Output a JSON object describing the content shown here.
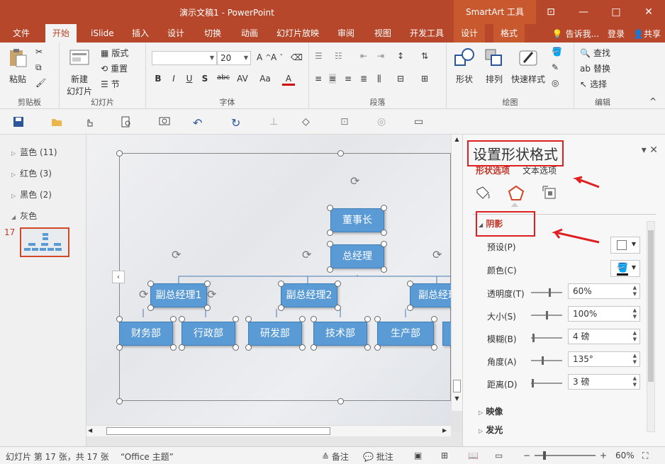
{
  "window": {
    "title": "演示文稿1 - PowerPoint",
    "context_tools": "SmartArt 工具"
  },
  "tabs": [
    "文件",
    "开始",
    "iSlide",
    "插入",
    "设计",
    "切换",
    "动画",
    "幻灯片放映",
    "审阅",
    "视图",
    "开发工具",
    "设计",
    "格式"
  ],
  "tabs_right": {
    "tell": "告诉我...",
    "login": "登录",
    "share": "共享"
  },
  "ribbon": {
    "clipboard": {
      "paste": "粘贴",
      "group": "剪贴板"
    },
    "slides": {
      "new_slide": "新建",
      "new_slide2": "幻灯片",
      "layout": "版式",
      "reset": "重置",
      "section": "节",
      "group": "幻灯片"
    },
    "font": {
      "name": "",
      "size": "20",
      "group": "字体",
      "bold": "B",
      "italic": "I",
      "underline": "U",
      "shadow": "S",
      "strike": "abc",
      "spacing": "AV",
      "case": "Aa",
      "color": "A"
    },
    "paragraph": {
      "group": "段落"
    },
    "drawing": {
      "shapes": "形状",
      "arrange": "排列",
      "quick_styles": "快速样式",
      "group": "绘图"
    },
    "editing": {
      "find": "查找",
      "replace": "替换",
      "select": "选择",
      "group": "编辑"
    }
  },
  "sections": [
    {
      "label": "蓝色 (11)"
    },
    {
      "label": "红色 (3)"
    },
    {
      "label": "黑色 (2)"
    },
    {
      "label": "灰色"
    }
  ],
  "slide_number": "17",
  "org": {
    "top1": "董事长",
    "top2": "总经理",
    "mid": [
      "副总经理1",
      "副总经理2",
      "副总经理"
    ],
    "bottom": [
      "财务部",
      "行政部",
      "研发部",
      "技术部",
      "生产部"
    ]
  },
  "format_pane": {
    "title": "设置形状格式",
    "tab_shape": "形状选项",
    "tab_text": "文本选项",
    "shadow": "阴影",
    "preset": "预设(P)",
    "color": "颜色(C)",
    "transparency": {
      "label": "透明度(T)",
      "value": "60%",
      "level": 0.6
    },
    "size": {
      "label": "大小(S)",
      "value": "100%",
      "level": 0.5
    },
    "blur": {
      "label": "模糊(B)",
      "value": "4 磅",
      "level": 0.05
    },
    "angle": {
      "label": "角度(A)",
      "value": "135°",
      "level": 0.375
    },
    "distance": {
      "label": "距离(D)",
      "value": "3 磅",
      "level": 0.03
    },
    "reflection": "映像",
    "glow": "发光"
  },
  "status": {
    "slide_info": "幻灯片 第 17 张，共 17 张",
    "theme": "“Office 主题”",
    "notes": "备注",
    "comments": "批注",
    "zoom": "60%"
  },
  "colors": {
    "accent": "#b7472a",
    "box": "#5b9bd5",
    "highlight": "#e02020"
  }
}
